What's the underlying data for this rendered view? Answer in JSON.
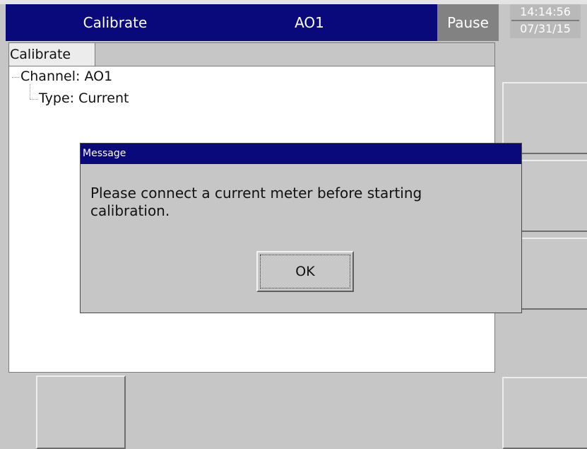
{
  "header": {
    "title": "Calibrate",
    "channel": "AO1",
    "status": "Pause",
    "time": "14:14:56",
    "date": "07/31/15"
  },
  "tabs": [
    {
      "label": "Calibrate",
      "active": true
    }
  ],
  "tree": {
    "channel_label": "Channel: AO1",
    "type_label": "Type: Current"
  },
  "dialog": {
    "title": "Message",
    "message": "Please connect a current meter before starting calibration.",
    "ok_label": "OK"
  },
  "colors": {
    "header_bg": "#09097c",
    "pause_bg": "#828282",
    "panel_bg": "#c6c6c6"
  }
}
